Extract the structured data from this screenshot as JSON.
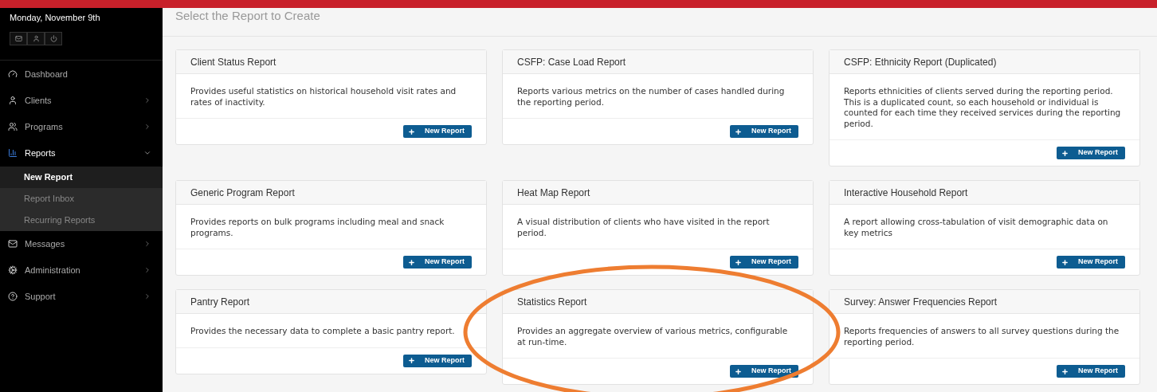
{
  "sidebar": {
    "date": "Monday, November 9th",
    "items": [
      {
        "label": "Dashboard",
        "has_children": false,
        "expanded": false,
        "selected": false
      },
      {
        "label": "Clients",
        "has_children": true,
        "expanded": false,
        "selected": false
      },
      {
        "label": "Programs",
        "has_children": true,
        "expanded": false,
        "selected": false
      },
      {
        "label": "Reports",
        "has_children": true,
        "expanded": true,
        "selected": true,
        "children": [
          {
            "label": "New Report",
            "selected": true
          },
          {
            "label": "Report Inbox",
            "selected": false
          },
          {
            "label": "Recurring Reports",
            "selected": false
          }
        ]
      },
      {
        "label": "Messages",
        "has_children": true,
        "expanded": false,
        "selected": false
      },
      {
        "label": "Administration",
        "has_children": true,
        "expanded": false,
        "selected": false
      },
      {
        "label": "Support",
        "has_children": true,
        "expanded": false,
        "selected": false
      }
    ]
  },
  "page_title": "Select the Report to Create",
  "reports": [
    {
      "title": "Client Status Report",
      "description": "Provides useful statistics on historical household visit rates and rates of inactivity.",
      "button": "New Report"
    },
    {
      "title": "CSFP: Case Load Report",
      "description": "Reports various metrics on the number of cases handled during the reporting period.",
      "button": "New Report"
    },
    {
      "title": "CSFP: Ethnicity Report (Duplicated)",
      "description": "Reports ethnicities of clients served during the reporting period. This is a duplicated count, so each household or individual is counted for each time they received services during the reporting period.",
      "button": "New Report"
    },
    {
      "title": "Generic Program Report",
      "description": "Provides reports on bulk programs including meal and snack programs.",
      "button": "New Report"
    },
    {
      "title": "Heat Map Report",
      "description": "A visual distribution of clients who have visited in the report period.",
      "button": "New Report"
    },
    {
      "title": "Interactive Household Report",
      "description": "A report allowing cross-tabulation of visit demographic data on key metrics",
      "button": "New Report"
    },
    {
      "title": "Pantry Report",
      "description": "Provides the necessary data to complete a basic pantry report.",
      "button": "New Report"
    },
    {
      "title": "Statistics Report",
      "description": "Provides an aggregate overview of various metrics, configurable at run-time.",
      "button": "New Report"
    },
    {
      "title": "Survey: Answer Frequencies Report",
      "description": "Reports frequencies of answers to all survey questions during the reporting period.",
      "button": "New Report"
    }
  ]
}
